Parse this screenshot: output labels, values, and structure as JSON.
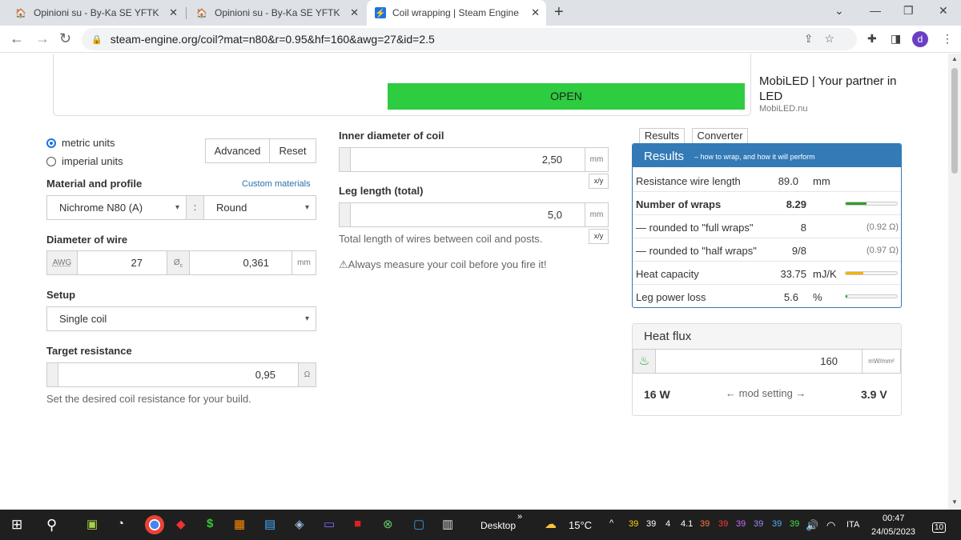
{
  "browser": {
    "tabs": [
      {
        "title": "Opinioni su - By-Ka SE YFTK E SX"
      },
      {
        "title": "Opinioni su - By-Ka SE YFTK E SX"
      },
      {
        "title": "Coil wrapping | Steam Engine | fre"
      }
    ],
    "url": "steam-engine.org/coil?mat=n80&r=0.95&hf=160&awg=27&id=2.5",
    "profile_initial": "d"
  },
  "ad": {
    "open_label": "OPEN",
    "side_title": "MobiLED | Your partner in LED",
    "side_sub": "MobiLED.nu"
  },
  "left": {
    "metric_label": "metric units",
    "imperial_label": "imperial units",
    "advanced_label": "Advanced",
    "reset_label": "Reset",
    "material_heading": "Material and profile",
    "custom_materials": "Custom materials",
    "material_value": "Nichrome N80 (A)",
    "profile_sep": ":",
    "profile_value": "Round",
    "diameter_heading": "Diameter of wire",
    "awg_label": "AWG",
    "awg_value": "27",
    "diam_symbol": "Ø",
    "diam_sub": "c",
    "diam_value": "0,361",
    "diam_unit": "mm",
    "setup_heading": "Setup",
    "setup_value": "Single coil",
    "target_heading": "Target resistance",
    "target_value": "0,95",
    "target_unit": "Ω",
    "target_help": "Set the desired coil resistance for your build."
  },
  "middle": {
    "inner_heading": "Inner diameter of coil",
    "inner_value": "2,50",
    "inner_unit": "mm",
    "ratio_label": "x/y",
    "leg_heading": "Leg length (total)",
    "leg_value": "5,0",
    "leg_unit": "mm",
    "leg_help": "Total length of wires between coil and posts.",
    "warning": "Always measure your coil before you fire it!"
  },
  "results": {
    "tab_results": "Results",
    "tab_converter": "Converter",
    "title": "Results",
    "subtitle": "– how to wrap, and how it will perform",
    "rows": [
      {
        "name": "Resistance wire length",
        "value": "89.0",
        "unit": "mm",
        "extra": "",
        "bold": false
      },
      {
        "name": "Number of wraps",
        "value": "8.29",
        "unit": "",
        "extra": "",
        "bold": true
      },
      {
        "name": "— rounded to \"full wraps\"",
        "value": "8",
        "unit": "",
        "extra": "(0.92 Ω)",
        "bold": false
      },
      {
        "name": "— rounded to \"half wraps\"",
        "value": "9/8",
        "unit": "",
        "extra": "(0.97 Ω)",
        "bold": false
      },
      {
        "name": "Heat capacity",
        "value": "33.75",
        "unit": "mJ/K",
        "extra": "",
        "bold": false
      },
      {
        "name": "Leg power loss",
        "value": "5.6",
        "unit": "%",
        "extra": "",
        "bold": false
      }
    ],
    "bars": {
      "wraps": 0.4,
      "heat": 0.35,
      "leg": 0.03
    },
    "colors": {
      "green": "#2e9e2e",
      "orange": "#f0b400",
      "blue": "#337ab7"
    }
  },
  "flux": {
    "title": "Heat flux",
    "value": "160",
    "unit": "mW/mm²",
    "power": "16 W",
    "mod": "← mod setting →",
    "voltage": "3.9 V"
  },
  "taskbar": {
    "desktop": "Desktop",
    "temp": "15°C",
    "tray_nums": [
      "39",
      "39",
      "4",
      "4.1",
      "39",
      "39",
      "39",
      "39",
      "39",
      "39"
    ],
    "lang": "ITA",
    "time": "00:47",
    "date": "24/05/2023",
    "notif": "10"
  }
}
